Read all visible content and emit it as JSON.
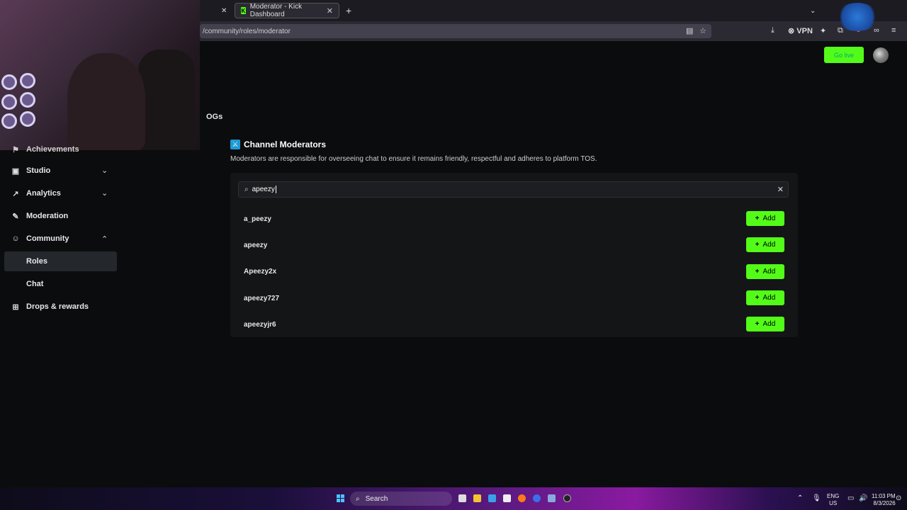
{
  "browser": {
    "tab_title": "Moderator - Kick Dashboard",
    "url": "/community/roles/moderator",
    "vpn_label": "VPN",
    "new_tab": "+"
  },
  "header": {
    "go_live_label": "Go live"
  },
  "sidebar": {
    "items": [
      {
        "label": "Achievements"
      },
      {
        "label": "Studio"
      },
      {
        "label": "Analytics"
      },
      {
        "label": "Moderation"
      },
      {
        "label": "Community"
      },
      {
        "label": "Drops & rewards"
      }
    ],
    "community_sub": [
      {
        "label": "Roles"
      },
      {
        "label": "Chat"
      }
    ]
  },
  "main": {
    "ogs_label": "OGs",
    "section_title": "Channel Moderators",
    "section_desc": "Moderators are responsible for overseeing chat to ensure it remains friendly, respectful and adheres to platform TOS.",
    "search_value": "apeezy",
    "add_label": "Add",
    "results": [
      {
        "name": "a_peezy"
      },
      {
        "name": "apeezy"
      },
      {
        "name": "Apeezy2x"
      },
      {
        "name": "apeezy727"
      },
      {
        "name": "apeezyjr6"
      }
    ]
  },
  "taskbar": {
    "search_placeholder": "Search",
    "lang_top": "ENG",
    "lang_bottom": "US",
    "time": "11:03 PM",
    "date": "8/3/2026"
  },
  "colors": {
    "kick_green": "#53fc18",
    "background": "#0b0c0d",
    "panel": "#141517"
  }
}
